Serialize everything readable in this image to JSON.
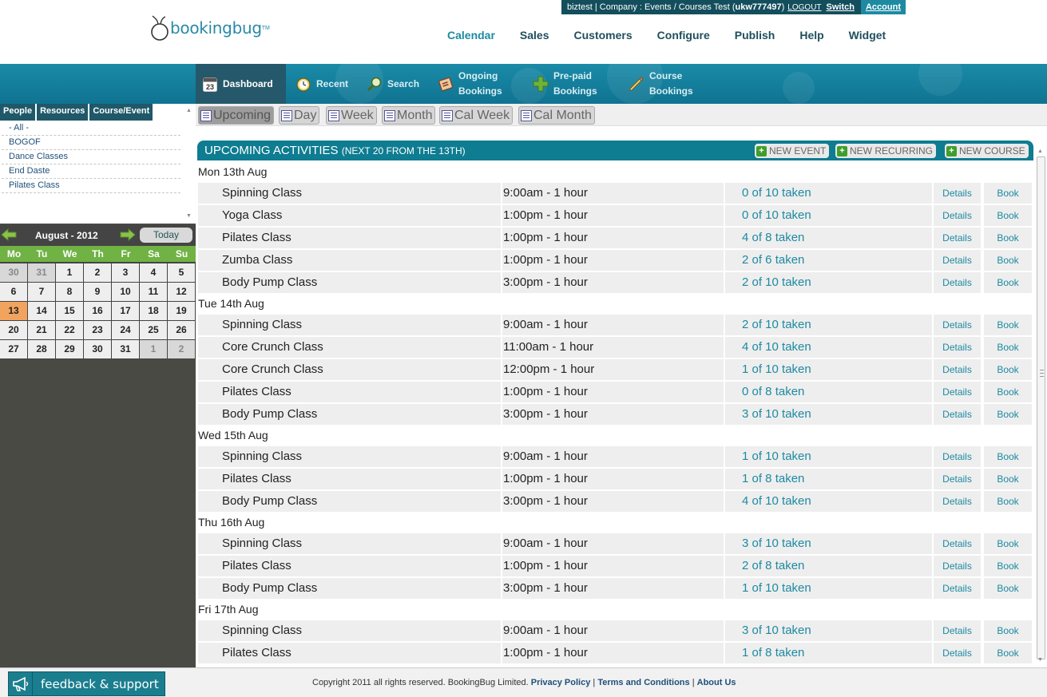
{
  "brand": {
    "name": "bookingbug",
    "tm": "TM"
  },
  "userbar": {
    "info": "biztest | Company : Events / Courses Test (",
    "account_id": "ukw777497",
    "info_end": ")",
    "logout": "LOGOUT",
    "switch": "Switch",
    "account": "Account"
  },
  "main_nav": [
    "Calendar",
    "Sales",
    "Customers",
    "Configure",
    "Publish",
    "Help",
    "Widget"
  ],
  "tabs": [
    {
      "label": "Dashboard",
      "icon": "calendar-23-icon",
      "icon_text": "23"
    },
    {
      "label": "Recent",
      "icon": "clock-icon"
    },
    {
      "label": "Search",
      "icon": "magnifier-icon"
    },
    {
      "label": "Ongoing Bookings",
      "line1": "Ongoing",
      "line2": "Bookings",
      "icon": "book-icon"
    },
    {
      "label": "Pre-paid Bookings",
      "line1": "Pre-paid",
      "line2": "Bookings",
      "icon": "plus-icon"
    },
    {
      "label": "Course Bookings",
      "line1": "Course",
      "line2": "Bookings",
      "icon": "pencil-icon"
    }
  ],
  "filter": {
    "tabs": [
      "People",
      "Resources",
      "Course/Event"
    ],
    "items": [
      "- All -",
      "BOGOF",
      "Dance Classes",
      "End Daste",
      "Pilates Class"
    ]
  },
  "calendar": {
    "month_label": "August - 2012",
    "today_label": "Today",
    "weekdays": [
      "Mo",
      "Tu",
      "We",
      "Th",
      "Fr",
      "Sa",
      "Su"
    ],
    "weeks": [
      [
        "30",
        "31",
        "1",
        "2",
        "3",
        "4",
        "5"
      ],
      [
        "6",
        "7",
        "8",
        "9",
        "10",
        "11",
        "12"
      ],
      [
        "13",
        "14",
        "15",
        "16",
        "17",
        "18",
        "19"
      ],
      [
        "20",
        "21",
        "22",
        "23",
        "24",
        "25",
        "26"
      ],
      [
        "27",
        "28",
        "29",
        "30",
        "31",
        "1",
        "2"
      ]
    ],
    "other_month": [
      [
        0,
        0
      ],
      [
        0,
        1
      ],
      [
        4,
        5
      ],
      [
        4,
        6
      ]
    ],
    "today": [
      2,
      0
    ]
  },
  "view_buttons": [
    "Upcoming",
    "Day",
    "Week",
    "Month",
    "Cal Week",
    "Cal Month"
  ],
  "upcoming": {
    "title": "UPCOMING ACTIVITIES",
    "subtitle": "(NEXT 20 FROM THE 13TH)",
    "new_buttons": [
      "NEW EVENT",
      "NEW RECURRING",
      "NEW COURSE"
    ],
    "details_label": "Details",
    "book_label": "Book",
    "days": [
      {
        "label": "Mon 13th Aug",
        "items": [
          {
            "name": "Spinning Class",
            "time": "9:00am - 1 hour",
            "taken": "0 of 10 taken"
          },
          {
            "name": "Yoga Class",
            "time": "1:00pm - 1 hour",
            "taken": "0 of 10 taken"
          },
          {
            "name": "Pilates Class",
            "time": "1:00pm - 1 hour",
            "taken": "4 of 8 taken"
          },
          {
            "name": "Zumba Class",
            "time": "1:00pm - 1 hour",
            "taken": "2 of 6 taken"
          },
          {
            "name": "Body Pump Class",
            "time": "3:00pm - 1 hour",
            "taken": "2 of 10 taken"
          }
        ]
      },
      {
        "label": "Tue 14th Aug",
        "items": [
          {
            "name": "Spinning Class",
            "time": "9:00am - 1 hour",
            "taken": "2 of 10 taken"
          },
          {
            "name": "Core Crunch Class",
            "time": "11:00am - 1 hour",
            "taken": "4 of 10 taken"
          },
          {
            "name": "Core Crunch Class",
            "time": "12:00pm - 1 hour",
            "taken": "1 of 10 taken"
          },
          {
            "name": "Pilates Class",
            "time": "1:00pm - 1 hour",
            "taken": "0 of 8 taken"
          },
          {
            "name": "Body Pump Class",
            "time": "3:00pm - 1 hour",
            "taken": "3 of 10 taken"
          }
        ]
      },
      {
        "label": "Wed 15th Aug",
        "items": [
          {
            "name": "Spinning Class",
            "time": "9:00am - 1 hour",
            "taken": "1 of 10 taken"
          },
          {
            "name": "Pilates Class",
            "time": "1:00pm - 1 hour",
            "taken": "1 of 8 taken"
          },
          {
            "name": "Body Pump Class",
            "time": "3:00pm - 1 hour",
            "taken": "4 of 10 taken"
          }
        ]
      },
      {
        "label": "Thu 16th Aug",
        "items": [
          {
            "name": "Spinning Class",
            "time": "9:00am - 1 hour",
            "taken": "3 of 10 taken"
          },
          {
            "name": "Pilates Class",
            "time": "1:00pm - 1 hour",
            "taken": "2 of 8 taken"
          },
          {
            "name": "Body Pump Class",
            "time": "3:00pm - 1 hour",
            "taken": "1 of 10 taken"
          }
        ]
      },
      {
        "label": "Fri 17th Aug",
        "items": [
          {
            "name": "Spinning Class",
            "time": "9:00am - 1 hour",
            "taken": "3 of 10 taken"
          },
          {
            "name": "Pilates Class",
            "time": "1:00pm - 1 hour",
            "taken": "1 of 8 taken"
          }
        ]
      }
    ]
  },
  "footer": {
    "feedback": "feedback & support",
    "copyright": "Copyright 2011 all rights reserved. BookingBug Limited.",
    "links": [
      "Privacy Policy",
      "Terms and Conditions",
      "About Us"
    ]
  },
  "colors": {
    "brand_teal": "#1d8aa2",
    "dark_teal": "#134e5c",
    "calendar_green": "#70b244",
    "today_orange": "#f2a45f"
  }
}
